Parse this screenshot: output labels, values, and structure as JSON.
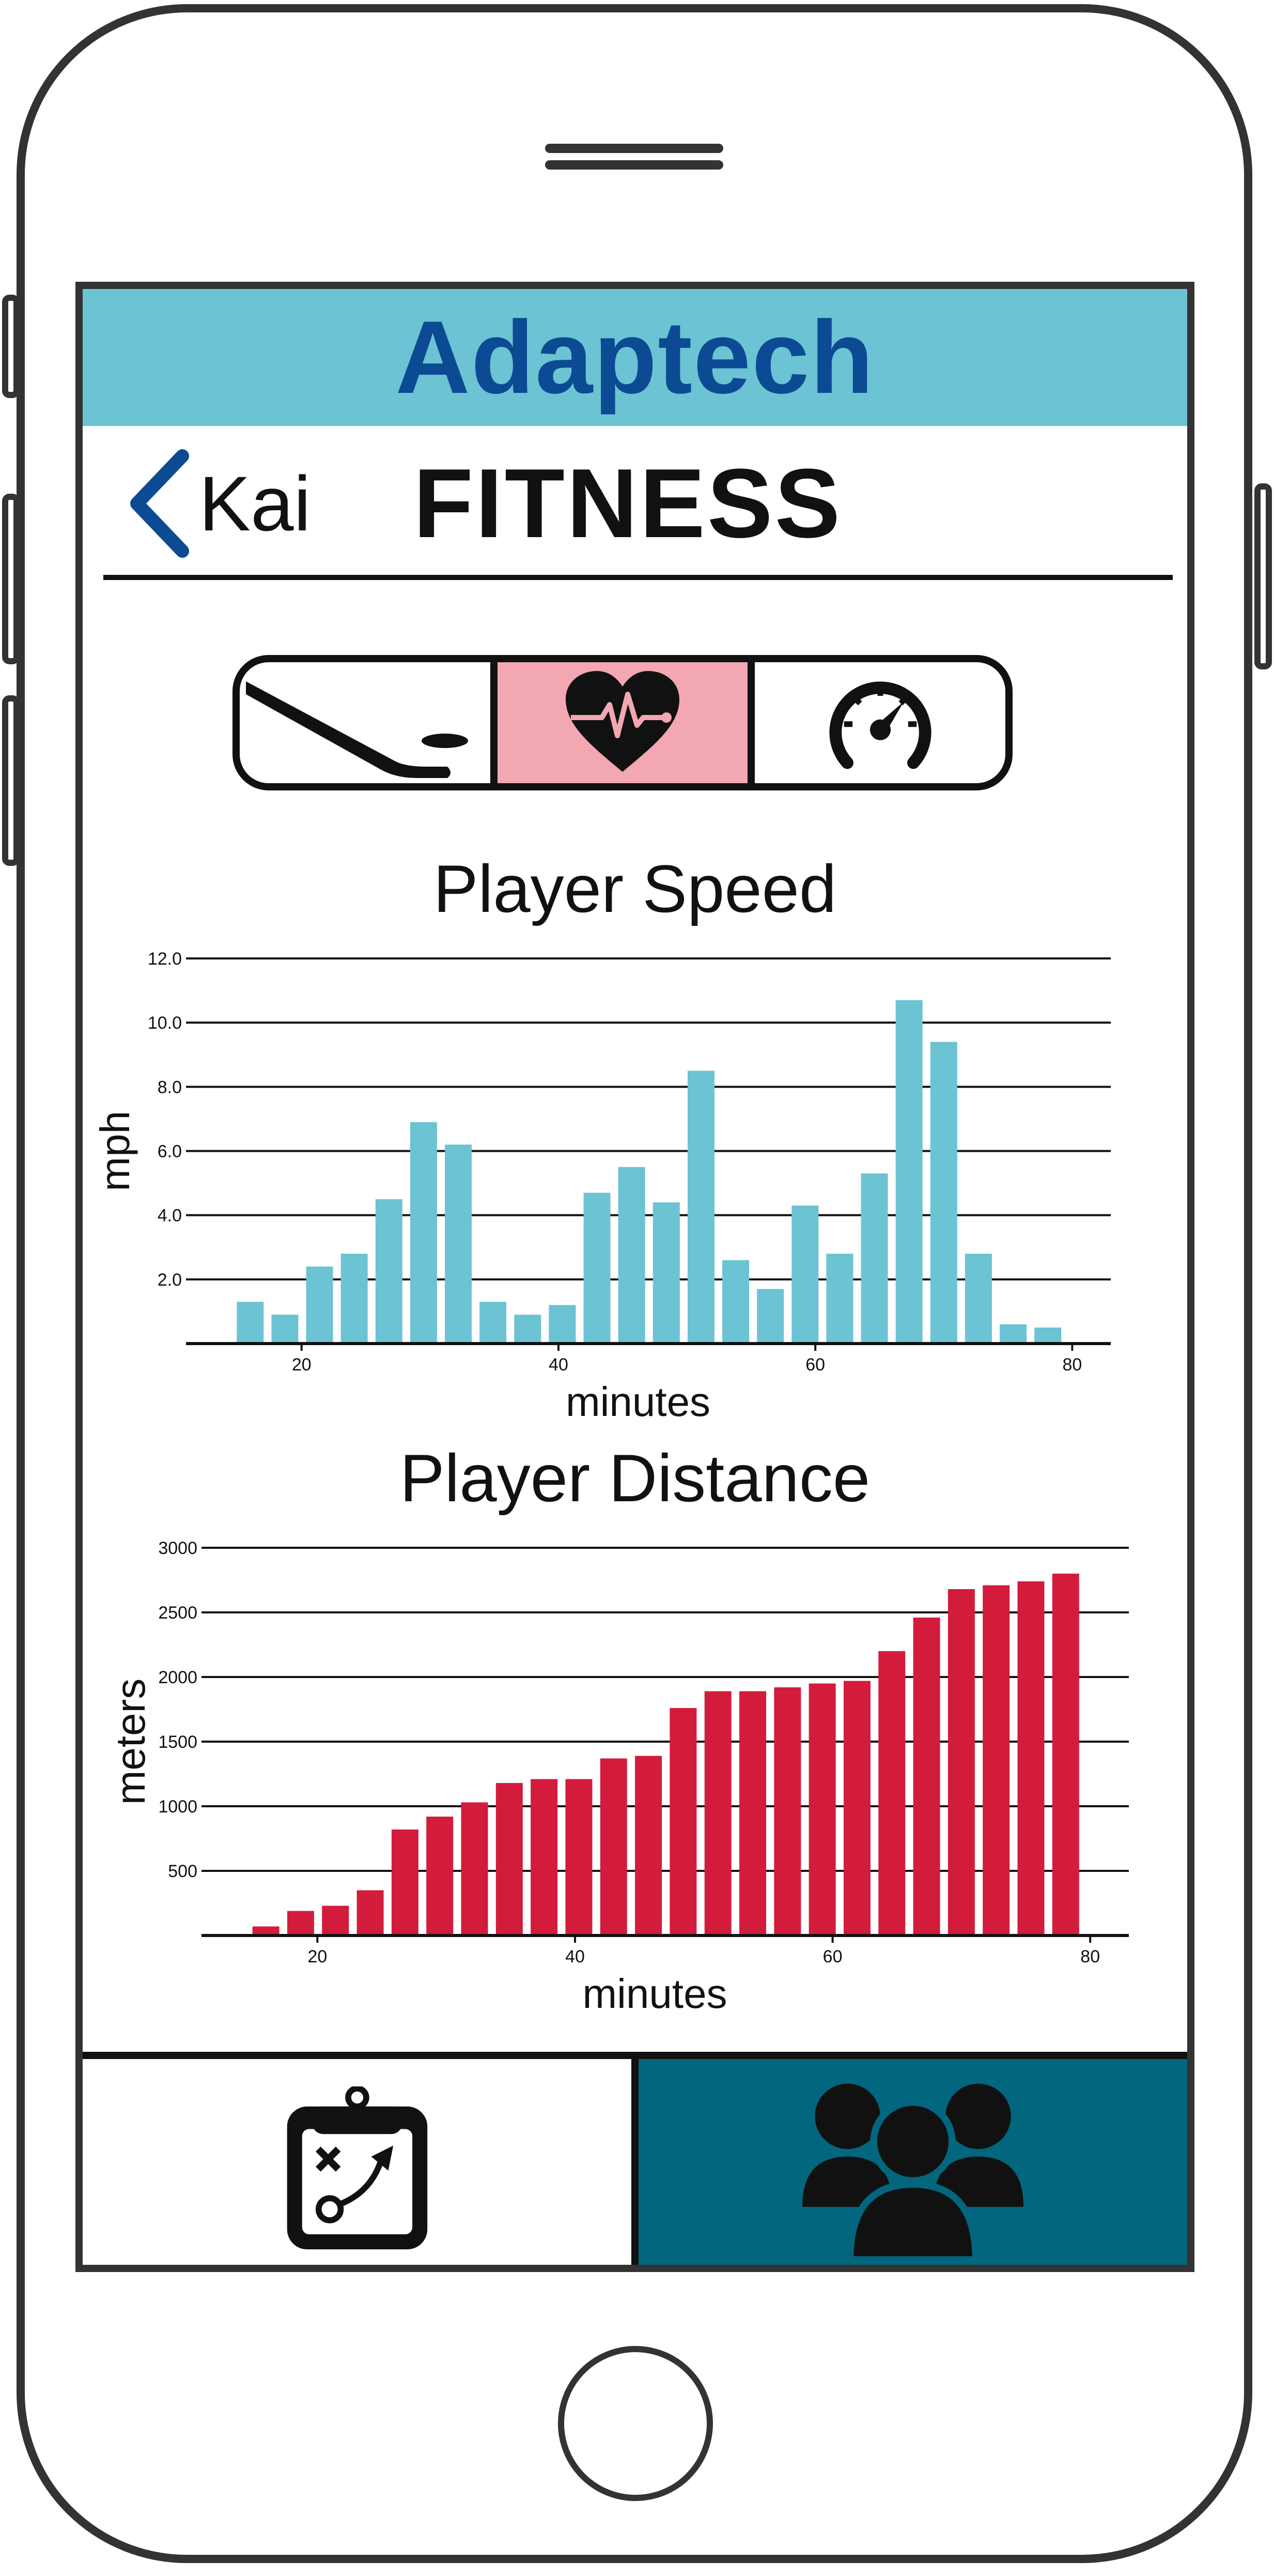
{
  "app": {
    "title": "Adaptech",
    "back_label": "Kai",
    "page_title": "FITNESS"
  },
  "colors": {
    "header_bg": "#6bc3d3",
    "title_color": "#0c4a94",
    "speed_bar": "#6bc3d3",
    "distance_bar": "#d31c3c",
    "active_tab_bg": "#f2a7b3",
    "active_nav_bg": "#02667e"
  },
  "tabs": [
    {
      "icon": "hockey-stick-icon",
      "active": false
    },
    {
      "icon": "heart-rate-icon",
      "active": true
    },
    {
      "icon": "speedometer-icon",
      "active": false
    }
  ],
  "bottom_nav": [
    {
      "icon": "playbook-clipboard-icon",
      "active": false
    },
    {
      "icon": "team-group-icon",
      "active": true
    }
  ],
  "chart_data": [
    {
      "type": "bar",
      "title": "Player Speed",
      "xlabel": "minutes",
      "ylabel": "mph",
      "x": [
        16,
        18,
        20,
        22,
        24,
        26,
        28,
        30,
        32,
        34,
        36,
        38,
        40,
        42,
        44,
        46,
        48,
        50,
        52,
        54,
        56,
        58,
        60,
        62,
        64,
        66,
        68,
        70,
        72,
        74,
        76,
        78
      ],
      "values": [
        1.3,
        0.9,
        2.4,
        2.8,
        4.5,
        6.9,
        6.2,
        1.3,
        0.9,
        1.2,
        4.7,
        5.5,
        4.4,
        8.5,
        2.6,
        1.7,
        4.3,
        2.8,
        5.3,
        10.7,
        9.4,
        2.8,
        0.6,
        0.5
      ],
      "bars_x": [
        16,
        18.7,
        21.4,
        24.1,
        26.8,
        29.5,
        32.2,
        34.9,
        37.6,
        40.3,
        43,
        45.7,
        48.4,
        51.1,
        53.8,
        56.5,
        59.2,
        61.9,
        64.6,
        67.3,
        70,
        72.7,
        75.4,
        78.1
      ],
      "xlim": [
        11,
        83
      ],
      "ylim": [
        0,
        12
      ],
      "yticks": [
        "2.0",
        "4.0",
        "6.0",
        "8.0",
        "10.0",
        "12.0"
      ],
      "ytick_values": [
        2,
        4,
        6,
        8,
        10,
        12
      ],
      "xticks": [
        "20",
        "40",
        "60",
        "80"
      ],
      "xtick_values": [
        20,
        40,
        60,
        80
      ],
      "grid": true
    },
    {
      "type": "bar",
      "title": "Player Distance",
      "xlabel": "minutes",
      "ylabel": "meters",
      "bars_x": [
        16,
        18.7,
        21.4,
        24.1,
        26.8,
        29.5,
        32.2,
        34.9,
        37.6,
        40.3,
        43,
        45.7,
        48.4,
        51.1,
        53.8,
        56.5,
        59.2,
        61.9,
        64.6,
        67.3,
        70,
        72.7,
        75.4,
        78.1
      ],
      "values": [
        70,
        190,
        230,
        350,
        820,
        920,
        1030,
        1180,
        1210,
        1210,
        1370,
        1390,
        1760,
        1890,
        1890,
        1920,
        1950,
        1970,
        2200,
        2460,
        2680,
        2710,
        2740,
        2800
      ],
      "xlim": [
        11,
        83
      ],
      "ylim": [
        0,
        3000
      ],
      "yticks": [
        "500",
        "1000",
        "1500",
        "2000",
        "2500",
        "3000"
      ],
      "ytick_values": [
        500,
        1000,
        1500,
        2000,
        2500,
        3000
      ],
      "xticks": [
        "20",
        "40",
        "60",
        "80"
      ],
      "xtick_values": [
        20,
        40,
        60,
        80
      ],
      "grid": true
    }
  ]
}
